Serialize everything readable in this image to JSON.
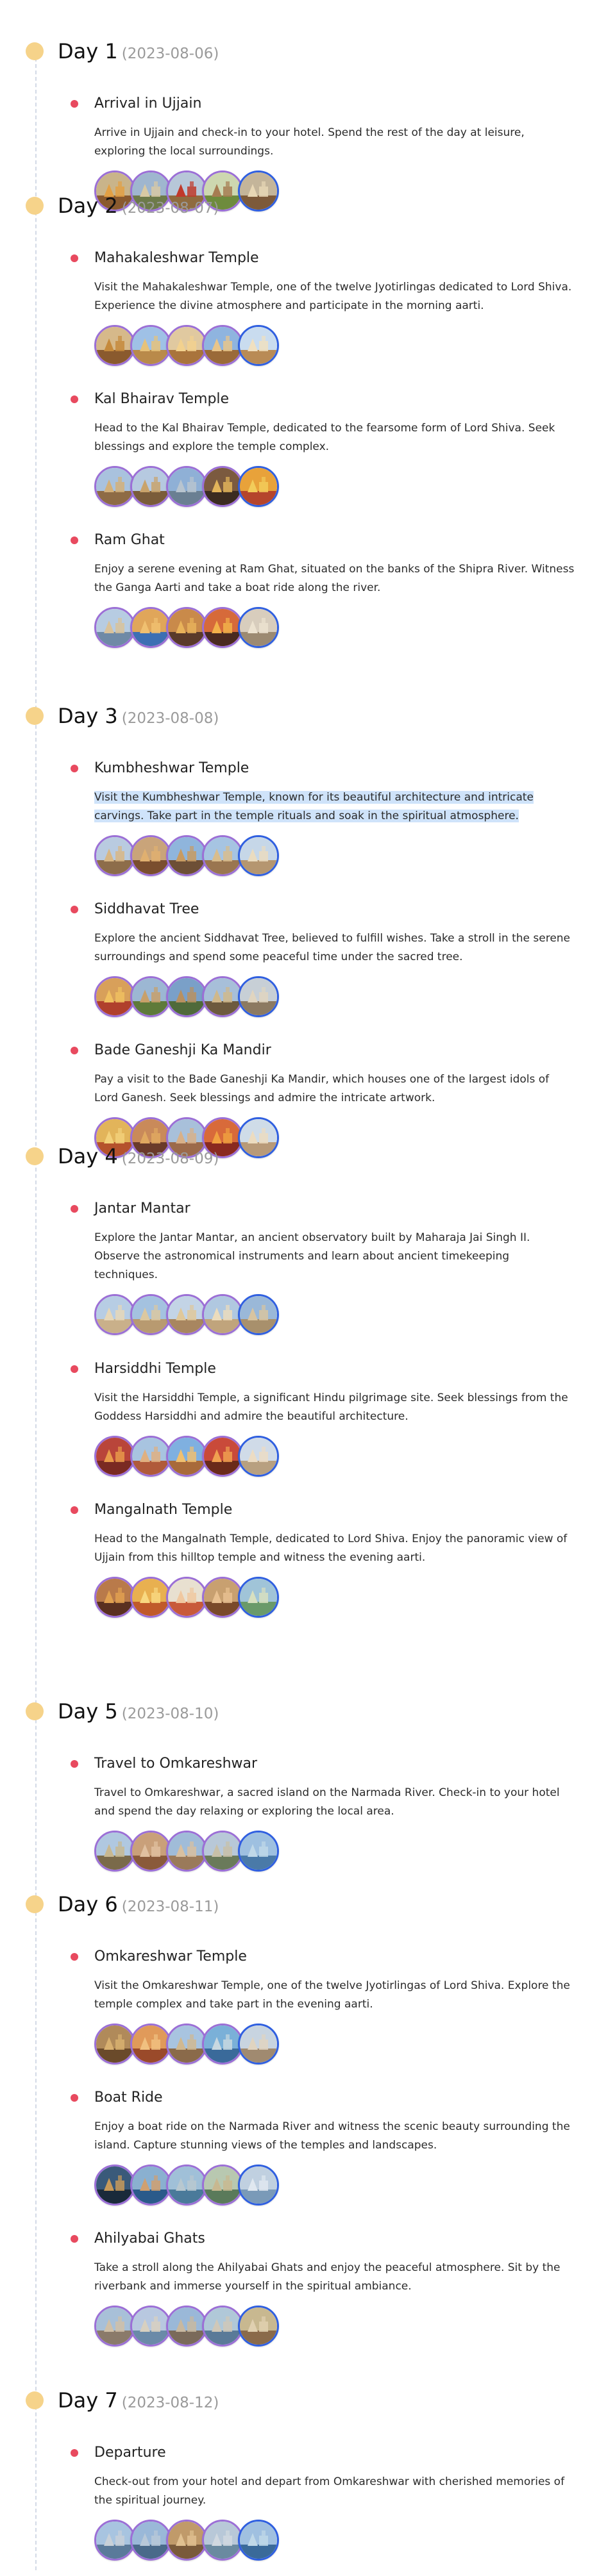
{
  "days": [
    {
      "title": "Day 1",
      "date": "(2023-08-06)",
      "activities": [
        {
          "title": "Arrival in Ujjain",
          "description": "Arrive in Ujjain and check-in to your hotel. Spend the rest of the day at leisure, exploring the local surroundings.",
          "photos": [
            {
              "sky": "#c9b48a",
              "ground": "#8a5a2e",
              "accent": "#e2a044"
            },
            {
              "sky": "#9fb6cf",
              "ground": "#6d7a4a",
              "accent": "#d8c9a4"
            },
            {
              "sky": "#b7c7d8",
              "ground": "#8f6b3f",
              "accent": "#c0392b"
            },
            {
              "sky": "#cdd7b0",
              "ground": "#6e8b3d",
              "accent": "#a67c52"
            },
            {
              "sky": "#c4b59a",
              "ground": "#7d5a3a",
              "accent": "#e8d7b5"
            }
          ]
        }
      ]
    },
    {
      "title": "Day 2",
      "date": "(2023-08-07)",
      "activities": [
        {
          "title": "Mahakaleshwar Temple",
          "description": "Visit the Mahakaleshwar Temple, one of the twelve Jyotirlingas dedicated to Lord Shiva. Experience the divine atmosphere and participate in the morning aarti.",
          "photos": [
            {
              "sky": "#d6b98a",
              "ground": "#8a5a2e",
              "accent": "#c58a3c"
            },
            {
              "sky": "#9fc1e6",
              "ground": "#b98a4a",
              "accent": "#e6c27a"
            },
            {
              "sky": "#e0c9a0",
              "ground": "#a9743c",
              "accent": "#f2d18e"
            },
            {
              "sky": "#8fb4df",
              "ground": "#9a6a38",
              "accent": "#e9c58a"
            },
            {
              "sky": "#c9dcef",
              "ground": "#b98b55",
              "accent": "#f0e0c0"
            }
          ]
        },
        {
          "title": "Kal Bhairav Temple",
          "description": "Head to the Kal Bhairav Temple, dedicated to the fearsome form of Lord Shiva. Seek blessings and explore the temple complex.",
          "photos": [
            {
              "sky": "#a9c2de",
              "ground": "#8e6b45",
              "accent": "#d3b07a"
            },
            {
              "sky": "#b6c9e0",
              "ground": "#7a5c3a",
              "accent": "#c9a36b"
            },
            {
              "sky": "#8fb0d6",
              "ground": "#6a7f92",
              "accent": "#b8c4cf"
            },
            {
              "sky": "#7b5a3f",
              "ground": "#3b2b20",
              "accent": "#e2b45a"
            },
            {
              "sky": "#e8a23a",
              "ground": "#b5452c",
              "accent": "#f2cc5a"
            }
          ]
        },
        {
          "title": "Ram Ghat",
          "description": "Enjoy a serene evening at Ram Ghat, situated on the banks of the Shipra River. Witness the Ganga Aarti and take a boat ride along the river.",
          "photos": [
            {
              "sky": "#b7cce2",
              "ground": "#6f8aa6",
              "accent": "#d9c29a"
            },
            {
              "sky": "#e0a65a",
              "ground": "#3c6fb3",
              "accent": "#f0c070"
            },
            {
              "sky": "#c98a4a",
              "ground": "#5a3a2a",
              "accent": "#e8b25a"
            },
            {
              "sky": "#d66a3a",
              "ground": "#4a2a20",
              "accent": "#f2b14a"
            },
            {
              "sky": "#d8cdbd",
              "ground": "#9c8a72",
              "accent": "#ece2d0"
            }
          ]
        }
      ]
    },
    {
      "title": "Day 3",
      "date": "(2023-08-08)",
      "activities": [
        {
          "title": "Kumbheshwar Temple",
          "description": "Visit the Kumbheshwar Temple, known for its beautiful architecture and intricate carvings. Take part in the temple rituals and soak in the spiritual atmosphere.",
          "selected": true,
          "photos": [
            {
              "sky": "#b9cbe0",
              "ground": "#8d6d4a",
              "accent": "#d8b785"
            },
            {
              "sky": "#c9a47a",
              "ground": "#7a4e2e",
              "accent": "#e0b070"
            },
            {
              "sky": "#8fb5dc",
              "ground": "#6d4f36",
              "accent": "#c89b62"
            },
            {
              "sky": "#a6c4e2",
              "ground": "#9a7650",
              "accent": "#d9bd8c"
            },
            {
              "sky": "#c6d7e8",
              "ground": "#b59670",
              "accent": "#eadcc0"
            }
          ]
        },
        {
          "title": "Siddhavat Tree",
          "description": "Explore the ancient Siddhavat Tree, believed to fulfill wishes. Take a stroll in the serene surroundings and spend some peaceful time under the sacred tree.",
          "photos": [
            {
              "sky": "#d8a05a",
              "ground": "#b0402c",
              "accent": "#f0c060"
            },
            {
              "sky": "#9cb7d3",
              "ground": "#5e7a3a",
              "accent": "#c8a06a"
            },
            {
              "sky": "#7aa0c8",
              "ground": "#4f6a3a",
              "accent": "#b89060"
            },
            {
              "sky": "#a7bfd9",
              "ground": "#6d5a3e",
              "accent": "#d0b88a"
            },
            {
              "sky": "#c7cfd6",
              "ground": "#8c7a62",
              "accent": "#e0d5c0"
            }
          ]
        },
        {
          "title": "Bade Ganeshji Ka Mandir",
          "description": "Pay a visit to the Bade Ganeshji Ka Mandir, which houses one of the largest idols of Lord Ganesh. Seek blessings and admire the intricate artwork.",
          "photos": [
            {
              "sky": "#e2b45a",
              "ground": "#b5522c",
              "accent": "#f2d07a"
            },
            {
              "sky": "#c98a5a",
              "ground": "#6a3a2a",
              "accent": "#e0a860"
            },
            {
              "sky": "#a8c0da",
              "ground": "#9c6a4a",
              "accent": "#d8b088"
            },
            {
              "sky": "#d86a3a",
              "ground": "#8a2a20",
              "accent": "#f0a040"
            },
            {
              "sky": "#cfdce8",
              "ground": "#b89a78",
              "accent": "#ecdcc0"
            }
          ]
        }
      ]
    },
    {
      "title": "Day 4",
      "date": "(2023-08-09)",
      "activities": [
        {
          "title": "Jantar Mantar",
          "description": "Explore the Jantar Mantar, an ancient observatory built by Maharaja Jai Singh II. Observe the astronomical instruments and learn about ancient timekeeping techniques.",
          "photos": [
            {
              "sky": "#b7cde4",
              "ground": "#c9b08a",
              "accent": "#e6d7b8"
            },
            {
              "sky": "#a4c2e0",
              "ground": "#b89a70",
              "accent": "#dcc8a0"
            },
            {
              "sky": "#c3d4e6",
              "ground": "#a88660",
              "accent": "#e0c89a"
            },
            {
              "sky": "#b0c8e0",
              "ground": "#c0a47c",
              "accent": "#ecdcbc"
            },
            {
              "sky": "#9ab8d8",
              "ground": "#a8906c",
              "accent": "#d8c4a0"
            }
          ]
        },
        {
          "title": "Harsiddhi Temple",
          "description": "Visit the Harsiddhi Temple, a significant Hindu pilgrimage site. Seek blessings from the Goddess Harsiddhi and admire the beautiful architecture.",
          "photos": [
            {
              "sky": "#b9453a",
              "ground": "#7a2a22",
              "accent": "#e89a4a"
            },
            {
              "sky": "#a8c4e0",
              "ground": "#b05a3a",
              "accent": "#e0b080"
            },
            {
              "sky": "#7fb0e0",
              "ground": "#a86a3a",
              "accent": "#f0c070"
            },
            {
              "sky": "#c94a3a",
              "ground": "#6a2a1a",
              "accent": "#f0a050"
            },
            {
              "sky": "#d0dbe8",
              "ground": "#b8a080",
              "accent": "#ecdcc4"
            }
          ]
        },
        {
          "title": "Mangalnath Temple",
          "description": "Head to the Mangalnath Temple, dedicated to Lord Shiva. Enjoy the panoramic view of Ujjain from this hilltop temple and witness the evening aarti.",
          "photos": [
            {
              "sky": "#b97a4a",
              "ground": "#5a3020",
              "accent": "#e0a050"
            },
            {
              "sky": "#e8b050",
              "ground": "#c05a2a",
              "accent": "#f8d880"
            },
            {
              "sky": "#e8e0d0",
              "ground": "#c85a3a",
              "accent": "#f0c8a0"
            },
            {
              "sky": "#c8a070",
              "ground": "#7a4a2a",
              "accent": "#e8c090"
            },
            {
              "sky": "#a0c4d8",
              "ground": "#6a9a6a",
              "accent": "#d8e0c0"
            }
          ]
        }
      ]
    },
    {
      "title": "Day 5",
      "date": "(2023-08-10)",
      "activities": [
        {
          "title": "Travel to Omkareshwar",
          "description": "Travel to Omkareshwar, a sacred island on the Narmada River. Check-in to your hotel and spend the day relaxing or exploring the local area.",
          "photos": [
            {
              "sky": "#b0c8e0",
              "ground": "#7a6a4a",
              "accent": "#c8b890"
            },
            {
              "sky": "#c9a07a",
              "ground": "#8a5a3a",
              "accent": "#e0c0a0"
            },
            {
              "sky": "#a0bcd8",
              "ground": "#9a7a5a",
              "accent": "#d8c0a0"
            },
            {
              "sky": "#b8c8d8",
              "ground": "#6a7a5a",
              "accent": "#c8c0a8"
            },
            {
              "sky": "#9ec0e0",
              "ground": "#4a7aa8",
              "accent": "#c0d8e8"
            }
          ]
        }
      ]
    },
    {
      "title": "Day 6",
      "date": "(2023-08-11)",
      "activities": [
        {
          "title": "Omkareshwar Temple",
          "description": "Visit the Omkareshwar Temple, one of the twelve Jyotirlingas of Lord Shiva. Explore the temple complex and take part in the evening aarti.",
          "photos": [
            {
              "sky": "#b08a5a",
              "ground": "#6a4a2a",
              "accent": "#d8b070"
            },
            {
              "sky": "#e09a5a",
              "ground": "#9a4a2a",
              "accent": "#f0c080"
            },
            {
              "sky": "#a8c4e0",
              "ground": "#8a6a4a",
              "accent": "#d0b890"
            },
            {
              "sky": "#7ab0d8",
              "ground": "#3a6a9a",
              "accent": "#c8d8e0"
            },
            {
              "sky": "#c8d4e0",
              "ground": "#a08a70",
              "accent": "#e0d4c0"
            }
          ]
        },
        {
          "title": "Boat Ride",
          "description": "Enjoy a boat ride on the Narmada River and witness the scenic beauty surrounding the island. Capture stunning views of the temples and landscapes.",
          "photos": [
            {
              "sky": "#3a5a7a",
              "ground": "#1a2a3a",
              "accent": "#c89a5a"
            },
            {
              "sky": "#8ab0d0",
              "ground": "#2a5a8a",
              "accent": "#d0a070"
            },
            {
              "sky": "#a0c0d8",
              "ground": "#4a7a9a",
              "accent": "#b8c8d0"
            },
            {
              "sky": "#b8c8b0",
              "ground": "#5a7a5a",
              "accent": "#c8b890"
            },
            {
              "sky": "#c0d0e0",
              "ground": "#7a9ab8",
              "accent": "#e0e8f0"
            }
          ]
        },
        {
          "title": "Ahilyabai Ghats",
          "description": "Take a stroll along the Ahilyabai Ghats and enjoy the peaceful atmosphere. Sit by the riverbank and immerse yourself in the spiritual ambiance.",
          "photos": [
            {
              "sky": "#a8c0d8",
              "ground": "#8a7a6a",
              "accent": "#d0c0a8"
            },
            {
              "sky": "#b8c8e0",
              "ground": "#6a8aa8",
              "accent": "#d8d0c0"
            },
            {
              "sky": "#9ab8d8",
              "ground": "#7a6a5a",
              "accent": "#c8b8a0"
            },
            {
              "sky": "#b0c8d8",
              "ground": "#5a7a98",
              "accent": "#d0c8b8"
            },
            {
              "sky": "#c8b890",
              "ground": "#8a6a4a",
              "accent": "#e0d0b0"
            }
          ]
        }
      ]
    },
    {
      "title": "Day 7",
      "date": "(2023-08-12)",
      "activities": [
        {
          "title": "Departure",
          "description": "Check-out from your hotel and depart from Omkareshwar with cherished memories of the spiritual journey.",
          "photos": [
            {
              "sky": "#a8c4e0",
              "ground": "#5a7a9a",
              "accent": "#c8d0d8"
            },
            {
              "sky": "#9ab8d8",
              "ground": "#4a6a8a",
              "accent": "#b8c8d8"
            },
            {
              "sky": "#c09a6a",
              "ground": "#7a5a3a",
              "accent": "#e0c090"
            },
            {
              "sky": "#b8c8d8",
              "ground": "#6a8aa0",
              "accent": "#d0d8e0"
            },
            {
              "sky": "#a0c0e0",
              "ground": "#3a6a9a",
              "accent": "#c0d8e8"
            }
          ]
        }
      ]
    }
  ]
}
